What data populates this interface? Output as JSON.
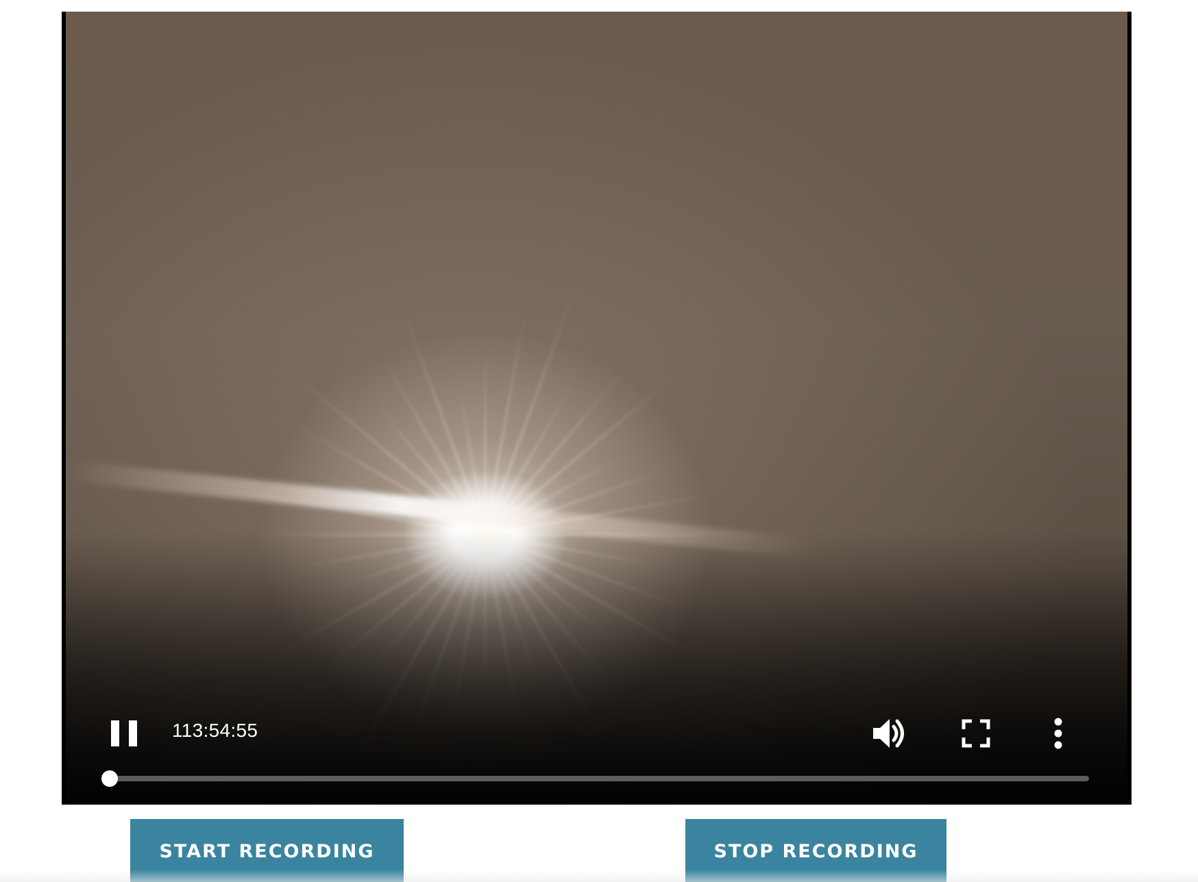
{
  "player": {
    "current_time": "113:54:55",
    "progress": 0,
    "state": "playing",
    "icons": {
      "play_pause": "pause-icon",
      "volume": "volume-icon",
      "fullscreen": "fullscreen-icon",
      "more": "more-vertical-icon"
    }
  },
  "buttons": {
    "start_label": "START RECORDING",
    "stop_label": "STOP RECORDING"
  },
  "colors": {
    "button_bg": "#3a84a0",
    "button_text": "#ffffff",
    "controls": "#ffffff"
  }
}
